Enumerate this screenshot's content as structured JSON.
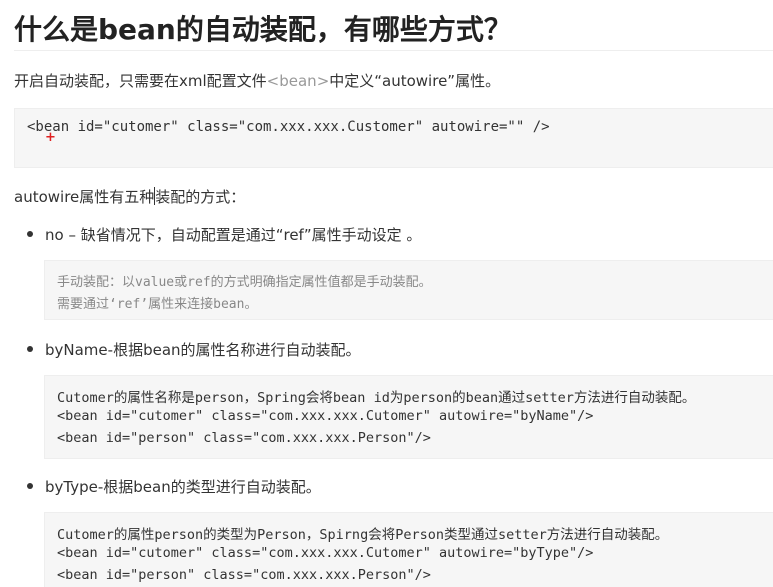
{
  "heading": "什么是bean的自动装配，有哪些方式？",
  "intro": {
    "before": "开启自动装配，只需要在xml配置文件",
    "tag": "<bean>",
    "after": "中定义“autowire”属性。"
  },
  "top_code": "<bean id=\"cutomer\" class=\"com.xxx.xxx.Customer\" autowire=\"\" />",
  "cursor_mark": "+",
  "para2": {
    "before": "autowire属性有五种",
    "after": "装配的方式："
  },
  "items": [
    {
      "label": "no – 缺省情况下，自动配置是通过“ref”属性手动设定 。",
      "code": [
        "手动装配：以value或ref的方式明确指定属性值都是手动装配。",
        "需要通过‘ref’属性来连接bean。"
      ]
    },
    {
      "label": "byName-根据bean的属性名称进行自动装配。",
      "code": [
        "Cutomer的属性名称是person，Spring会将bean id为person的bean通过setter方法进行自动装配。",
        "<bean id=\"cutomer\" class=\"com.xxx.xxx.Cutomer\" autowire=\"byName\"/>",
        "<bean id=\"person\" class=\"com.xxx.xxx.Person\"/>"
      ]
    },
    {
      "label": "byType-根据bean的类型进行自动装配。",
      "code": [
        "Cutomer的属性person的类型为Person，Spirng会将Person类型通过setter方法进行自动装配。",
        "<bean id=\"cutomer\" class=\"com.xxx.xxx.Cutomer\" autowire=\"byType\"/>",
        "<bean id=\"person\" class=\"com.xxx.xxx.Person\"/>"
      ]
    }
  ]
}
